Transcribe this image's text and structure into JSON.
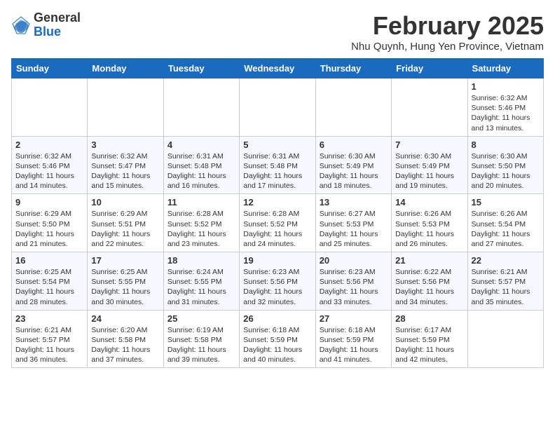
{
  "header": {
    "logo_general": "General",
    "logo_blue": "Blue",
    "month_title": "February 2025",
    "location": "Nhu Quynh, Hung Yen Province, Vietnam"
  },
  "days_of_week": [
    "Sunday",
    "Monday",
    "Tuesday",
    "Wednesday",
    "Thursday",
    "Friday",
    "Saturday"
  ],
  "weeks": [
    [
      {
        "day": "",
        "info": ""
      },
      {
        "day": "",
        "info": ""
      },
      {
        "day": "",
        "info": ""
      },
      {
        "day": "",
        "info": ""
      },
      {
        "day": "",
        "info": ""
      },
      {
        "day": "",
        "info": ""
      },
      {
        "day": "1",
        "info": "Sunrise: 6:32 AM\nSunset: 5:46 PM\nDaylight: 11 hours\nand 13 minutes."
      }
    ],
    [
      {
        "day": "2",
        "info": "Sunrise: 6:32 AM\nSunset: 5:46 PM\nDaylight: 11 hours\nand 14 minutes."
      },
      {
        "day": "3",
        "info": "Sunrise: 6:32 AM\nSunset: 5:47 PM\nDaylight: 11 hours\nand 15 minutes."
      },
      {
        "day": "4",
        "info": "Sunrise: 6:31 AM\nSunset: 5:48 PM\nDaylight: 11 hours\nand 16 minutes."
      },
      {
        "day": "5",
        "info": "Sunrise: 6:31 AM\nSunset: 5:48 PM\nDaylight: 11 hours\nand 17 minutes."
      },
      {
        "day": "6",
        "info": "Sunrise: 6:30 AM\nSunset: 5:49 PM\nDaylight: 11 hours\nand 18 minutes."
      },
      {
        "day": "7",
        "info": "Sunrise: 6:30 AM\nSunset: 5:49 PM\nDaylight: 11 hours\nand 19 minutes."
      },
      {
        "day": "8",
        "info": "Sunrise: 6:30 AM\nSunset: 5:50 PM\nDaylight: 11 hours\nand 20 minutes."
      }
    ],
    [
      {
        "day": "9",
        "info": "Sunrise: 6:29 AM\nSunset: 5:50 PM\nDaylight: 11 hours\nand 21 minutes."
      },
      {
        "day": "10",
        "info": "Sunrise: 6:29 AM\nSunset: 5:51 PM\nDaylight: 11 hours\nand 22 minutes."
      },
      {
        "day": "11",
        "info": "Sunrise: 6:28 AM\nSunset: 5:52 PM\nDaylight: 11 hours\nand 23 minutes."
      },
      {
        "day": "12",
        "info": "Sunrise: 6:28 AM\nSunset: 5:52 PM\nDaylight: 11 hours\nand 24 minutes."
      },
      {
        "day": "13",
        "info": "Sunrise: 6:27 AM\nSunset: 5:53 PM\nDaylight: 11 hours\nand 25 minutes."
      },
      {
        "day": "14",
        "info": "Sunrise: 6:26 AM\nSunset: 5:53 PM\nDaylight: 11 hours\nand 26 minutes."
      },
      {
        "day": "15",
        "info": "Sunrise: 6:26 AM\nSunset: 5:54 PM\nDaylight: 11 hours\nand 27 minutes."
      }
    ],
    [
      {
        "day": "16",
        "info": "Sunrise: 6:25 AM\nSunset: 5:54 PM\nDaylight: 11 hours\nand 28 minutes."
      },
      {
        "day": "17",
        "info": "Sunrise: 6:25 AM\nSunset: 5:55 PM\nDaylight: 11 hours\nand 30 minutes."
      },
      {
        "day": "18",
        "info": "Sunrise: 6:24 AM\nSunset: 5:55 PM\nDaylight: 11 hours\nand 31 minutes."
      },
      {
        "day": "19",
        "info": "Sunrise: 6:23 AM\nSunset: 5:56 PM\nDaylight: 11 hours\nand 32 minutes."
      },
      {
        "day": "20",
        "info": "Sunrise: 6:23 AM\nSunset: 5:56 PM\nDaylight: 11 hours\nand 33 minutes."
      },
      {
        "day": "21",
        "info": "Sunrise: 6:22 AM\nSunset: 5:56 PM\nDaylight: 11 hours\nand 34 minutes."
      },
      {
        "day": "22",
        "info": "Sunrise: 6:21 AM\nSunset: 5:57 PM\nDaylight: 11 hours\nand 35 minutes."
      }
    ],
    [
      {
        "day": "23",
        "info": "Sunrise: 6:21 AM\nSunset: 5:57 PM\nDaylight: 11 hours\nand 36 minutes."
      },
      {
        "day": "24",
        "info": "Sunrise: 6:20 AM\nSunset: 5:58 PM\nDaylight: 11 hours\nand 37 minutes."
      },
      {
        "day": "25",
        "info": "Sunrise: 6:19 AM\nSunset: 5:58 PM\nDaylight: 11 hours\nand 39 minutes."
      },
      {
        "day": "26",
        "info": "Sunrise: 6:18 AM\nSunset: 5:59 PM\nDaylight: 11 hours\nand 40 minutes."
      },
      {
        "day": "27",
        "info": "Sunrise: 6:18 AM\nSunset: 5:59 PM\nDaylight: 11 hours\nand 41 minutes."
      },
      {
        "day": "28",
        "info": "Sunrise: 6:17 AM\nSunset: 5:59 PM\nDaylight: 11 hours\nand 42 minutes."
      },
      {
        "day": "",
        "info": ""
      }
    ]
  ]
}
